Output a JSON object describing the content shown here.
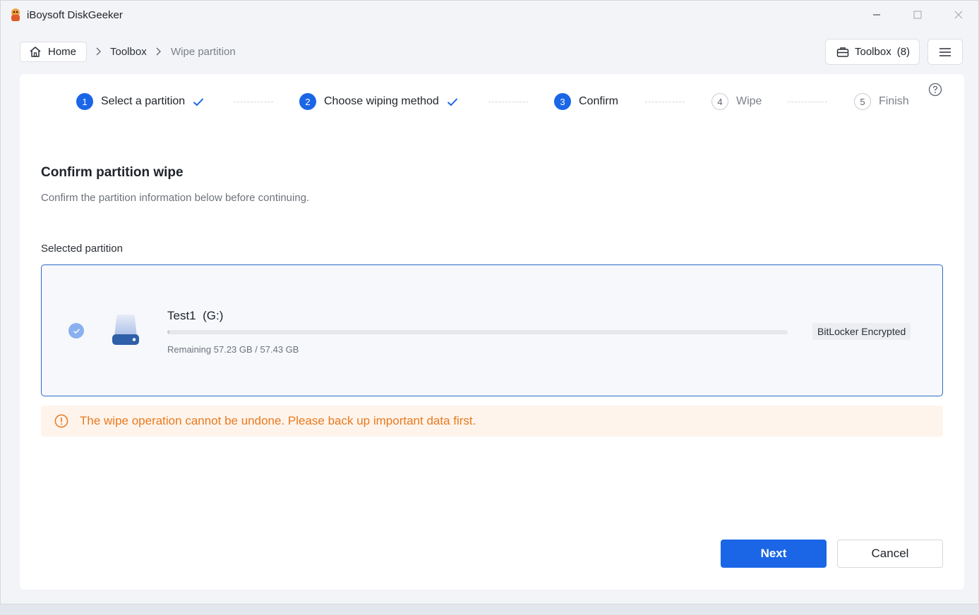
{
  "app": {
    "title": "iBoysoft DiskGeeker"
  },
  "breadcrumb": {
    "home_label": "Home",
    "items": [
      "Toolbox",
      "Wipe partition"
    ]
  },
  "header": {
    "toolbox_label": "Toolbox",
    "toolbox_count": "(8)"
  },
  "steps": [
    {
      "num": "1",
      "label": "Select a partition",
      "state": "done"
    },
    {
      "num": "2",
      "label": "Choose wiping method",
      "state": "done"
    },
    {
      "num": "3",
      "label": "Confirm",
      "state": "active"
    },
    {
      "num": "4",
      "label": "Wipe",
      "state": "pending"
    },
    {
      "num": "5",
      "label": "Finish",
      "state": "pending"
    }
  ],
  "main": {
    "title": "Confirm partition wipe",
    "subtitle": "Confirm the partition information below before continuing.",
    "selected_label": "Selected partition"
  },
  "partition": {
    "name": "Test1",
    "drive": "(G:)",
    "remaining": "Remaining 57.23 GB / 57.43 GB",
    "used_fraction": 0.0035,
    "badge": "BitLocker Encrypted"
  },
  "warning": {
    "text": "The wipe operation cannot be undone. Please back up important data first."
  },
  "actions": {
    "next_label": "Next",
    "cancel_label": "Cancel"
  },
  "colors": {
    "accent": "#1a66e6",
    "warning": "#e87a20",
    "warning_bg": "#fef4eb",
    "selected_border": "#2e69c6"
  },
  "icons": {
    "home": "home-icon",
    "toolbox": "briefcase-icon",
    "menu": "hamburger-menu-icon",
    "help": "question-circle-icon",
    "step_done": "checkmark-icon",
    "disk": "hard-drive-icon",
    "warning": "exclamation-circle-icon"
  }
}
